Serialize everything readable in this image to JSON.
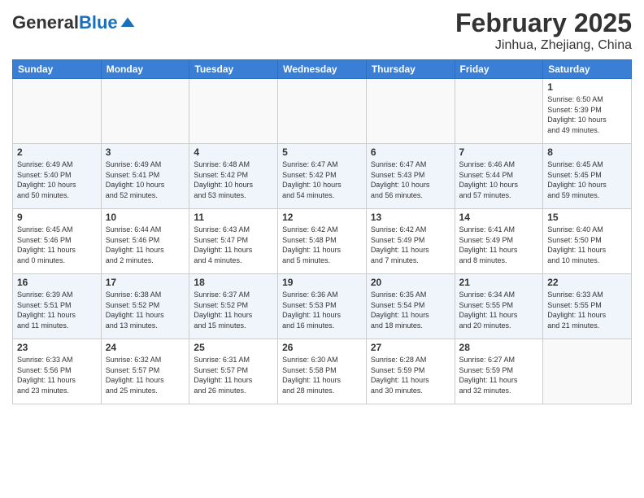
{
  "header": {
    "logo": {
      "general": "General",
      "blue": "Blue"
    },
    "title": "February 2025",
    "location": "Jinhua, Zhejiang, China"
  },
  "days_of_week": [
    "Sunday",
    "Monday",
    "Tuesday",
    "Wednesday",
    "Thursday",
    "Friday",
    "Saturday"
  ],
  "weeks": [
    [
      {
        "day": "",
        "info": ""
      },
      {
        "day": "",
        "info": ""
      },
      {
        "day": "",
        "info": ""
      },
      {
        "day": "",
        "info": ""
      },
      {
        "day": "",
        "info": ""
      },
      {
        "day": "",
        "info": ""
      },
      {
        "day": "1",
        "info": "Sunrise: 6:50 AM\nSunset: 5:39 PM\nDaylight: 10 hours\nand 49 minutes."
      }
    ],
    [
      {
        "day": "2",
        "info": "Sunrise: 6:49 AM\nSunset: 5:40 PM\nDaylight: 10 hours\nand 50 minutes."
      },
      {
        "day": "3",
        "info": "Sunrise: 6:49 AM\nSunset: 5:41 PM\nDaylight: 10 hours\nand 52 minutes."
      },
      {
        "day": "4",
        "info": "Sunrise: 6:48 AM\nSunset: 5:42 PM\nDaylight: 10 hours\nand 53 minutes."
      },
      {
        "day": "5",
        "info": "Sunrise: 6:47 AM\nSunset: 5:42 PM\nDaylight: 10 hours\nand 54 minutes."
      },
      {
        "day": "6",
        "info": "Sunrise: 6:47 AM\nSunset: 5:43 PM\nDaylight: 10 hours\nand 56 minutes."
      },
      {
        "day": "7",
        "info": "Sunrise: 6:46 AM\nSunset: 5:44 PM\nDaylight: 10 hours\nand 57 minutes."
      },
      {
        "day": "8",
        "info": "Sunrise: 6:45 AM\nSunset: 5:45 PM\nDaylight: 10 hours\nand 59 minutes."
      }
    ],
    [
      {
        "day": "9",
        "info": "Sunrise: 6:45 AM\nSunset: 5:46 PM\nDaylight: 11 hours\nand 0 minutes."
      },
      {
        "day": "10",
        "info": "Sunrise: 6:44 AM\nSunset: 5:46 PM\nDaylight: 11 hours\nand 2 minutes."
      },
      {
        "day": "11",
        "info": "Sunrise: 6:43 AM\nSunset: 5:47 PM\nDaylight: 11 hours\nand 4 minutes."
      },
      {
        "day": "12",
        "info": "Sunrise: 6:42 AM\nSunset: 5:48 PM\nDaylight: 11 hours\nand 5 minutes."
      },
      {
        "day": "13",
        "info": "Sunrise: 6:42 AM\nSunset: 5:49 PM\nDaylight: 11 hours\nand 7 minutes."
      },
      {
        "day": "14",
        "info": "Sunrise: 6:41 AM\nSunset: 5:49 PM\nDaylight: 11 hours\nand 8 minutes."
      },
      {
        "day": "15",
        "info": "Sunrise: 6:40 AM\nSunset: 5:50 PM\nDaylight: 11 hours\nand 10 minutes."
      }
    ],
    [
      {
        "day": "16",
        "info": "Sunrise: 6:39 AM\nSunset: 5:51 PM\nDaylight: 11 hours\nand 11 minutes."
      },
      {
        "day": "17",
        "info": "Sunrise: 6:38 AM\nSunset: 5:52 PM\nDaylight: 11 hours\nand 13 minutes."
      },
      {
        "day": "18",
        "info": "Sunrise: 6:37 AM\nSunset: 5:52 PM\nDaylight: 11 hours\nand 15 minutes."
      },
      {
        "day": "19",
        "info": "Sunrise: 6:36 AM\nSunset: 5:53 PM\nDaylight: 11 hours\nand 16 minutes."
      },
      {
        "day": "20",
        "info": "Sunrise: 6:35 AM\nSunset: 5:54 PM\nDaylight: 11 hours\nand 18 minutes."
      },
      {
        "day": "21",
        "info": "Sunrise: 6:34 AM\nSunset: 5:55 PM\nDaylight: 11 hours\nand 20 minutes."
      },
      {
        "day": "22",
        "info": "Sunrise: 6:33 AM\nSunset: 5:55 PM\nDaylight: 11 hours\nand 21 minutes."
      }
    ],
    [
      {
        "day": "23",
        "info": "Sunrise: 6:33 AM\nSunset: 5:56 PM\nDaylight: 11 hours\nand 23 minutes."
      },
      {
        "day": "24",
        "info": "Sunrise: 6:32 AM\nSunset: 5:57 PM\nDaylight: 11 hours\nand 25 minutes."
      },
      {
        "day": "25",
        "info": "Sunrise: 6:31 AM\nSunset: 5:57 PM\nDaylight: 11 hours\nand 26 minutes."
      },
      {
        "day": "26",
        "info": "Sunrise: 6:30 AM\nSunset: 5:58 PM\nDaylight: 11 hours\nand 28 minutes."
      },
      {
        "day": "27",
        "info": "Sunrise: 6:28 AM\nSunset: 5:59 PM\nDaylight: 11 hours\nand 30 minutes."
      },
      {
        "day": "28",
        "info": "Sunrise: 6:27 AM\nSunset: 5:59 PM\nDaylight: 11 hours\nand 32 minutes."
      },
      {
        "day": "",
        "info": ""
      }
    ]
  ]
}
